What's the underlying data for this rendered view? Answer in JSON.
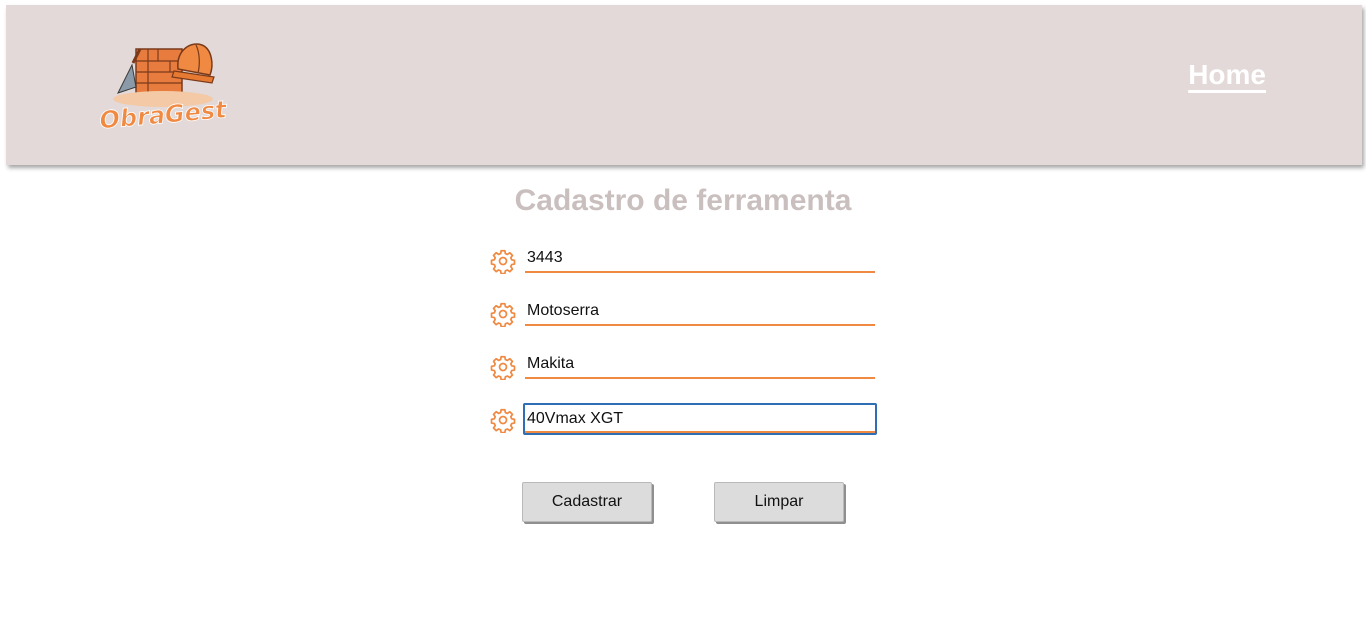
{
  "header": {
    "logo_text": "ObraGest",
    "nav_home": "Home"
  },
  "form": {
    "title": "Cadastro de ferramenta",
    "fields": [
      {
        "icon": "gear-icon",
        "value": "3443"
      },
      {
        "icon": "gear-icon",
        "value": "Motoserra"
      },
      {
        "icon": "gear-icon",
        "value": "Makita"
      },
      {
        "icon": "gear-icon",
        "value": "40Vmax XGT"
      }
    ],
    "submit_label": "Cadastrar",
    "clear_label": "Limpar"
  },
  "colors": {
    "header_bg": "#e2d9d8",
    "accent": "#f08a43",
    "title": "#c9bfbe",
    "focus": "#2f6db4"
  }
}
